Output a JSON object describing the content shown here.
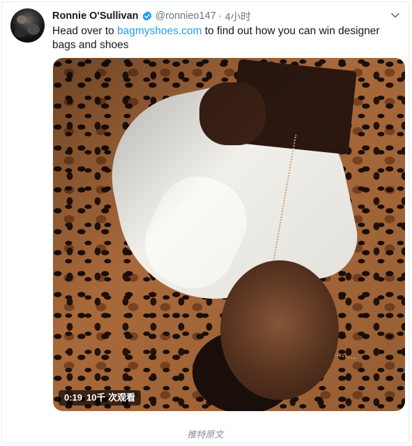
{
  "tweet": {
    "author_name": "Ronnie O'Sullivan",
    "handle": "@ronnieo147",
    "separator": "·",
    "time": "4小时",
    "text_before": "Head over to ",
    "link": "bagmyshoes.com",
    "text_after": " to find out how you can win designer bags and shoes"
  },
  "video": {
    "duration": "0:19",
    "views": "10千 次观看"
  },
  "footer": {
    "label": "推特原文"
  },
  "colors": {
    "link": "#1da1f2",
    "verified": "#1da1f2",
    "secondary_text": "#657786"
  },
  "icons": {
    "verified": "verified-badge-icon",
    "chevron": "chevron-down-icon"
  }
}
